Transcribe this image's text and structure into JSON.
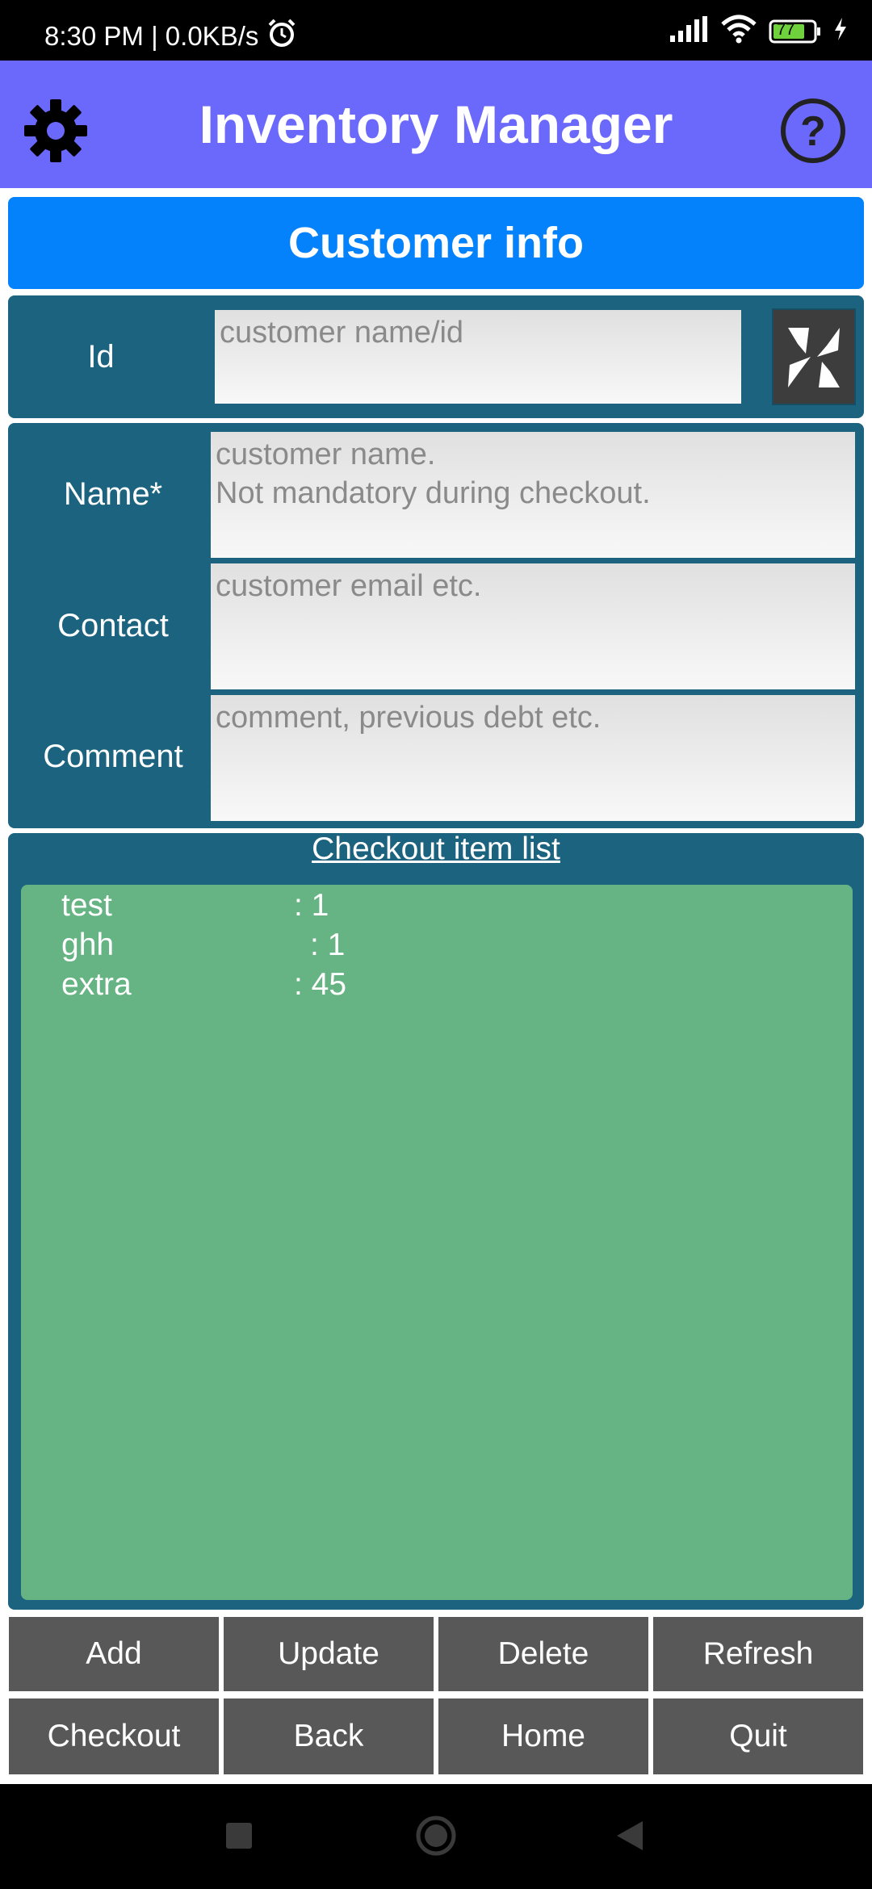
{
  "status_bar": {
    "time": "8:30 PM | 0.0KB/s",
    "battery": "77"
  },
  "header": {
    "title": "Inventory Manager"
  },
  "section": {
    "title": "Customer info"
  },
  "id_row": {
    "label": "Id",
    "placeholder": "customer name/id"
  },
  "name_row": {
    "label": "Name*",
    "placeholder": "customer name.\nNot mandatory during checkout."
  },
  "contact_row": {
    "label": "Contact",
    "placeholder": "customer email etc."
  },
  "comment_row": {
    "label": "Comment",
    "placeholder": "comment, previous debt etc."
  },
  "checkout": {
    "title": "Checkout item list",
    "items": [
      {
        "name": "test",
        "qty": ": 1"
      },
      {
        "name": "ghh",
        "qty": ": 1"
      },
      {
        "name": "extra",
        "qty": ": 45"
      }
    ]
  },
  "buttons": {
    "add": "Add",
    "update": "Update",
    "delete": "Delete",
    "refresh": "Refresh",
    "checkout": "Checkout",
    "back": "Back",
    "home": "Home",
    "quit": "Quit"
  },
  "icons": {
    "settings": "gear-icon",
    "help": "help-icon",
    "scan": "barcode-scan-icon",
    "alarm": "alarm-icon",
    "signal": "signal-icon",
    "wifi": "wifi-icon",
    "battery": "battery-icon",
    "charging": "charging-icon"
  },
  "colors": {
    "header": "#6b68fc",
    "section": "#0482fb",
    "panel": "#1b637f",
    "list": "#66b383",
    "button": "#585858"
  }
}
